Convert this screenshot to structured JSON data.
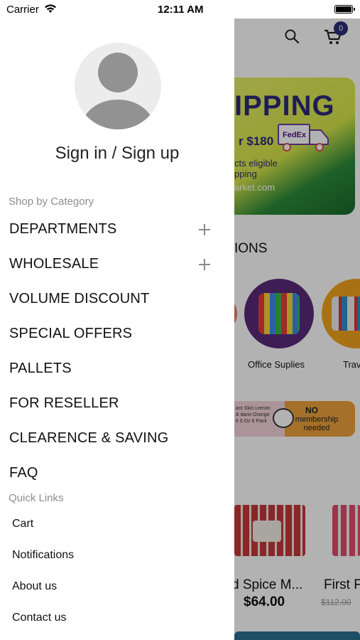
{
  "status_bar": {
    "carrier": "Carrier",
    "time": "12:11 AM"
  },
  "drawer": {
    "sign_in_label": "Sign in / Sign up",
    "shop_by_category_label": "Shop by Category",
    "categories": [
      {
        "label": "DEPARTMENTS",
        "expandable": true
      },
      {
        "label": "WHOLESALE",
        "expandable": true
      },
      {
        "label": "VOLUME DISCOUNT",
        "expandable": false
      },
      {
        "label": "SPECIAL OFFERS",
        "expandable": false
      },
      {
        "label": "PALLETS",
        "expandable": false
      },
      {
        "label": "FOR RESELLER",
        "expandable": false
      },
      {
        "label": "CLEARENCE & SAVING",
        "expandable": false
      },
      {
        "label": "FAQ",
        "expandable": false
      }
    ],
    "quick_links_label": "Quick Links",
    "quick_links": [
      "Cart",
      "Notifications",
      "About us",
      "Contact us"
    ]
  },
  "background_app": {
    "cart_count": "0",
    "banner": {
      "title_fragment": "IPPING",
      "line1": "r $180",
      "line2": "cts eligible",
      "line2b": "pping",
      "line3": "arket.com",
      "truck_brand": "FedEx"
    },
    "section_title_fragment": "IONS",
    "categories": [
      {
        "label": "Office Suplies"
      },
      {
        "label": "Trav"
      }
    ],
    "promo": {
      "small_text": "ant Skin Lemon & darin Orange 6 6 Oz 6 Pack",
      "headline": "NO",
      "sub": "membership needed"
    },
    "products": [
      {
        "name": "d Spice M...",
        "price": "$64.00"
      },
      {
        "name": "First F",
        "old_price": "$112.00"
      }
    ]
  },
  "colors": {
    "brand_navy": "#2b2f77",
    "drawer_bg": "#ffffff",
    "muted_text": "#8e8e8e",
    "overlay": "rgba(0,0,0,0.30)"
  }
}
